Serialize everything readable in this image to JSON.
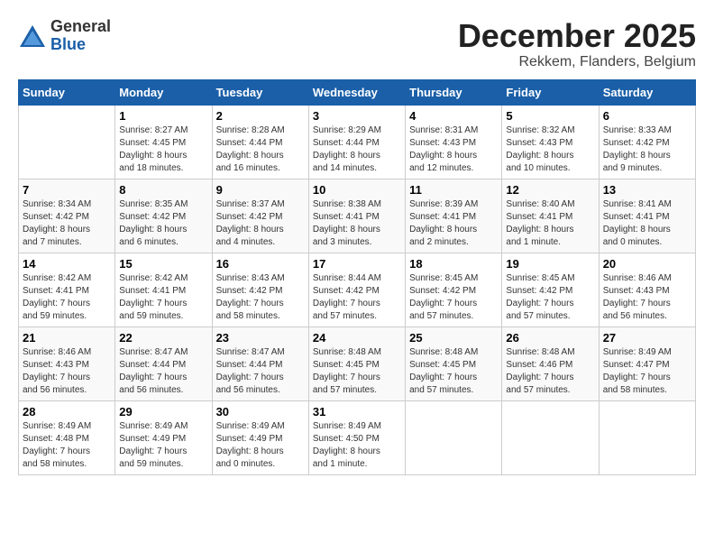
{
  "logo": {
    "general": "General",
    "blue": "Blue"
  },
  "title": "December 2025",
  "subtitle": "Rekkem, Flanders, Belgium",
  "days_of_week": [
    "Sunday",
    "Monday",
    "Tuesday",
    "Wednesday",
    "Thursday",
    "Friday",
    "Saturday"
  ],
  "weeks": [
    [
      {
        "day": "",
        "details": ""
      },
      {
        "day": "1",
        "details": "Sunrise: 8:27 AM\nSunset: 4:45 PM\nDaylight: 8 hours\nand 18 minutes."
      },
      {
        "day": "2",
        "details": "Sunrise: 8:28 AM\nSunset: 4:44 PM\nDaylight: 8 hours\nand 16 minutes."
      },
      {
        "day": "3",
        "details": "Sunrise: 8:29 AM\nSunset: 4:44 PM\nDaylight: 8 hours\nand 14 minutes."
      },
      {
        "day": "4",
        "details": "Sunrise: 8:31 AM\nSunset: 4:43 PM\nDaylight: 8 hours\nand 12 minutes."
      },
      {
        "day": "5",
        "details": "Sunrise: 8:32 AM\nSunset: 4:43 PM\nDaylight: 8 hours\nand 10 minutes."
      },
      {
        "day": "6",
        "details": "Sunrise: 8:33 AM\nSunset: 4:42 PM\nDaylight: 8 hours\nand 9 minutes."
      }
    ],
    [
      {
        "day": "7",
        "details": "Sunrise: 8:34 AM\nSunset: 4:42 PM\nDaylight: 8 hours\nand 7 minutes."
      },
      {
        "day": "8",
        "details": "Sunrise: 8:35 AM\nSunset: 4:42 PM\nDaylight: 8 hours\nand 6 minutes."
      },
      {
        "day": "9",
        "details": "Sunrise: 8:37 AM\nSunset: 4:42 PM\nDaylight: 8 hours\nand 4 minutes."
      },
      {
        "day": "10",
        "details": "Sunrise: 8:38 AM\nSunset: 4:41 PM\nDaylight: 8 hours\nand 3 minutes."
      },
      {
        "day": "11",
        "details": "Sunrise: 8:39 AM\nSunset: 4:41 PM\nDaylight: 8 hours\nand 2 minutes."
      },
      {
        "day": "12",
        "details": "Sunrise: 8:40 AM\nSunset: 4:41 PM\nDaylight: 8 hours\nand 1 minute."
      },
      {
        "day": "13",
        "details": "Sunrise: 8:41 AM\nSunset: 4:41 PM\nDaylight: 8 hours\nand 0 minutes."
      }
    ],
    [
      {
        "day": "14",
        "details": "Sunrise: 8:42 AM\nSunset: 4:41 PM\nDaylight: 7 hours\nand 59 minutes."
      },
      {
        "day": "15",
        "details": "Sunrise: 8:42 AM\nSunset: 4:41 PM\nDaylight: 7 hours\nand 59 minutes."
      },
      {
        "day": "16",
        "details": "Sunrise: 8:43 AM\nSunset: 4:42 PM\nDaylight: 7 hours\nand 58 minutes."
      },
      {
        "day": "17",
        "details": "Sunrise: 8:44 AM\nSunset: 4:42 PM\nDaylight: 7 hours\nand 57 minutes."
      },
      {
        "day": "18",
        "details": "Sunrise: 8:45 AM\nSunset: 4:42 PM\nDaylight: 7 hours\nand 57 minutes."
      },
      {
        "day": "19",
        "details": "Sunrise: 8:45 AM\nSunset: 4:42 PM\nDaylight: 7 hours\nand 57 minutes."
      },
      {
        "day": "20",
        "details": "Sunrise: 8:46 AM\nSunset: 4:43 PM\nDaylight: 7 hours\nand 56 minutes."
      }
    ],
    [
      {
        "day": "21",
        "details": "Sunrise: 8:46 AM\nSunset: 4:43 PM\nDaylight: 7 hours\nand 56 minutes."
      },
      {
        "day": "22",
        "details": "Sunrise: 8:47 AM\nSunset: 4:44 PM\nDaylight: 7 hours\nand 56 minutes."
      },
      {
        "day": "23",
        "details": "Sunrise: 8:47 AM\nSunset: 4:44 PM\nDaylight: 7 hours\nand 56 minutes."
      },
      {
        "day": "24",
        "details": "Sunrise: 8:48 AM\nSunset: 4:45 PM\nDaylight: 7 hours\nand 57 minutes."
      },
      {
        "day": "25",
        "details": "Sunrise: 8:48 AM\nSunset: 4:45 PM\nDaylight: 7 hours\nand 57 minutes."
      },
      {
        "day": "26",
        "details": "Sunrise: 8:48 AM\nSunset: 4:46 PM\nDaylight: 7 hours\nand 57 minutes."
      },
      {
        "day": "27",
        "details": "Sunrise: 8:49 AM\nSunset: 4:47 PM\nDaylight: 7 hours\nand 58 minutes."
      }
    ],
    [
      {
        "day": "28",
        "details": "Sunrise: 8:49 AM\nSunset: 4:48 PM\nDaylight: 7 hours\nand 58 minutes."
      },
      {
        "day": "29",
        "details": "Sunrise: 8:49 AM\nSunset: 4:49 PM\nDaylight: 7 hours\nand 59 minutes."
      },
      {
        "day": "30",
        "details": "Sunrise: 8:49 AM\nSunset: 4:49 PM\nDaylight: 8 hours\nand 0 minutes."
      },
      {
        "day": "31",
        "details": "Sunrise: 8:49 AM\nSunset: 4:50 PM\nDaylight: 8 hours\nand 1 minute."
      },
      {
        "day": "",
        "details": ""
      },
      {
        "day": "",
        "details": ""
      },
      {
        "day": "",
        "details": ""
      }
    ]
  ]
}
